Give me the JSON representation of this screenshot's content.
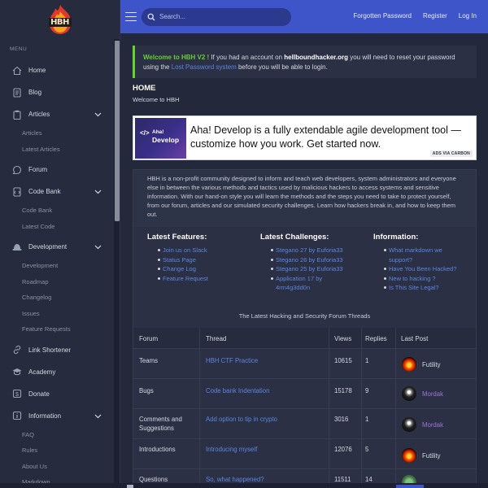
{
  "brand": {
    "logo_text": "HBH"
  },
  "sidebar": {
    "menu_label": "MENU",
    "items": [
      {
        "label": "Home",
        "icon": "home-icon"
      },
      {
        "label": "Blog",
        "icon": "document-icon"
      },
      {
        "label": "Articles",
        "icon": "clipboard-icon",
        "sub": [
          "Articles",
          "Latest Articles"
        ]
      },
      {
        "label": "Forum",
        "icon": "chat-icon"
      },
      {
        "label": "Code Bank",
        "icon": "folder-icon",
        "sub": [
          "Code Bank",
          "Latest Code"
        ]
      },
      {
        "label": "Development",
        "icon": "hat-icon",
        "sub": [
          "Development",
          "Roadmap",
          "Changelog",
          "Issues",
          "Feature Requests"
        ]
      },
      {
        "label": "Link Shortener",
        "icon": "link-icon"
      },
      {
        "label": "Academy",
        "icon": "academy-icon"
      },
      {
        "label": "Donate",
        "icon": "donate-icon"
      },
      {
        "label": "Information",
        "icon": "info-icon",
        "sub": [
          "FAQ",
          "Rules",
          "About Us",
          "Markdown"
        ]
      }
    ]
  },
  "topbar": {
    "search_placeholder": "Search...",
    "links": [
      "Forgotten Password",
      "Register",
      "Log In"
    ]
  },
  "welcome": {
    "strong": "Welcome to HBH V2 !",
    "text1": " If you had an account on ",
    "domain": "hellboundhacker.org",
    "text2": " you will need to reset your password using the ",
    "link": "Lost Password system",
    "text3": " before you will be able to login."
  },
  "page": {
    "title": "HOME",
    "subtitle": "Welcome to HBH"
  },
  "ad": {
    "img_symbol": "</>",
    "img_line1": "Aha!",
    "img_line2": "Develop",
    "text": "Aha! Develop is a fully extendable agile development tool — customize how you work. Get started now.",
    "via": "ADS VIA CARBON"
  },
  "about": "HBH is a non-profit community designed to inform and teach web developers, system administrators and everyone else in between the various methods and tactics used by malicious hackers to access systems and sensitive information. With our hand-on style you will learn the methods and the steps you need to take to protect yourself, from our forum, articles and our simulated security challenges. Learn how hackers break in, and how to keep them out.",
  "columns": [
    {
      "title": "Latest Features:",
      "items": [
        "Join us on Slack",
        "Status Page",
        "Change Log",
        "Feature Request"
      ]
    },
    {
      "title": "Latest Challenges:",
      "items": [
        "Stegano 27 by Euforia33",
        "Stegano 26 by Euforia33",
        "Stegano 25 by Euforia33",
        "Application 17 by 4rm4g3dd0n"
      ]
    },
    {
      "title": "Information:",
      "items": [
        "What markdown we support?",
        "Have You Been Hacked?",
        "New to hacking ?",
        "Is This Site Legal?"
      ]
    }
  ],
  "threads": {
    "caption": "The Latest Hacking and Security Forum Threads",
    "headers": [
      "Forum",
      "Thread",
      "Views",
      "Replies",
      "Last Post"
    ],
    "rows": [
      {
        "forum": "Teams",
        "thread": "HBH CTF Practice",
        "views": "10615",
        "replies": "1",
        "last_post": "Futility",
        "avatar": "fire"
      },
      {
        "forum": "Bugs",
        "thread": "Code bank Indentation",
        "views": "15178",
        "replies": "9",
        "last_post": "Mordak",
        "avatar": "dark"
      },
      {
        "forum": "Comments and Suggestions",
        "thread": "Add option to tip in crypto",
        "views": "3016",
        "replies": "1",
        "last_post": "Mordak",
        "avatar": "dark"
      },
      {
        "forum": "Introductions",
        "thread": "Introducing myself",
        "views": "12076",
        "replies": "5",
        "last_post": "Futility",
        "avatar": "fire"
      },
      {
        "forum": "Questions",
        "thread": "So, what happened?",
        "views": "11511",
        "replies": "14",
        "last_post": "",
        "avatar": "green"
      }
    ]
  },
  "colors": {
    "accent": "#3d55c8",
    "link": "#5c86e0",
    "success": "#66d12f",
    "background": "#23283a",
    "sidebar": "#262c3d"
  }
}
